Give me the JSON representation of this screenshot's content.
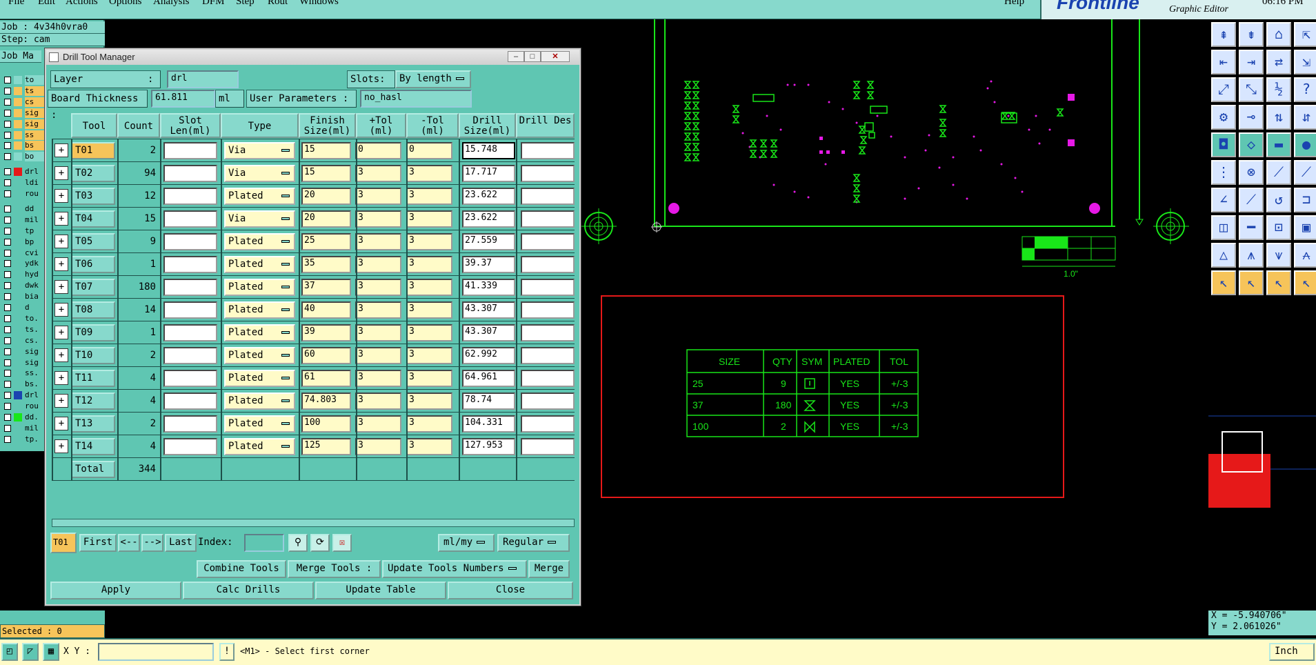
{
  "menubar": {
    "items": [
      "File",
      "Edit",
      "Actions",
      "Options",
      "Analysis",
      "DFM",
      "Step",
      "Rout",
      "Windows",
      "Help"
    ],
    "brand": "Frontline",
    "app_name": "Graphic Editor",
    "time": "06:16 PM"
  },
  "left_panel": {
    "job": "Job : 4v34h0vra0",
    "step": "Step: cam",
    "job_matrix": "Job Ma",
    "layers": [
      "to",
      "ts",
      "cs",
      "sig",
      "sig",
      "ss",
      "bs",
      "bo",
      "drl",
      "ldi",
      "rou",
      "dd",
      "mil",
      "tp",
      "bp",
      "cvi",
      "ydk",
      "hyd",
      "dwk",
      "bia",
      "d",
      "to.",
      "ts.",
      "cs.",
      "sig",
      "sig",
      "ss.",
      "bs.",
      "drl",
      "rou",
      "dd.",
      "mil",
      "tp."
    ],
    "selected": "Selected : 0"
  },
  "dialog": {
    "title": "Drill Tool Manager",
    "layer_label": "Layer",
    "layer_sep": ":",
    "layer_value": "drl",
    "slots_label": "Slots:",
    "slots_value": "By length",
    "board_thickness_label": "Board Thickness :",
    "board_thickness_value": "61.811",
    "board_thickness_unit": "ml",
    "user_params_label": "User Parameters :",
    "user_params_value": "no_hasl",
    "columns": [
      "Tool",
      "Count",
      "Slot Len(ml)",
      "Type",
      "Finish Size(ml)",
      "+Tol (ml)",
      "-Tol (ml)",
      "Drill Size(ml)",
      "Drill Des"
    ],
    "rows": [
      {
        "tool": "T01",
        "count": "2",
        "type": "Via",
        "finish": "15",
        "ptol": "0",
        "mtol": "0",
        "drill": "15.748"
      },
      {
        "tool": "T02",
        "count": "94",
        "type": "Via",
        "finish": "15",
        "ptol": "3",
        "mtol": "3",
        "drill": "17.717"
      },
      {
        "tool": "T03",
        "count": "12",
        "type": "Plated",
        "finish": "20",
        "ptol": "3",
        "mtol": "3",
        "drill": "23.622"
      },
      {
        "tool": "T04",
        "count": "15",
        "type": "Via",
        "finish": "20",
        "ptol": "3",
        "mtol": "3",
        "drill": "23.622"
      },
      {
        "tool": "T05",
        "count": "9",
        "type": "Plated",
        "finish": "25",
        "ptol": "3",
        "mtol": "3",
        "drill": "27.559"
      },
      {
        "tool": "T06",
        "count": "1",
        "type": "Plated",
        "finish": "35",
        "ptol": "3",
        "mtol": "3",
        "drill": "39.37"
      },
      {
        "tool": "T07",
        "count": "180",
        "type": "Plated",
        "finish": "37",
        "ptol": "3",
        "mtol": "3",
        "drill": "41.339"
      },
      {
        "tool": "T08",
        "count": "14",
        "type": "Plated",
        "finish": "40",
        "ptol": "3",
        "mtol": "3",
        "drill": "43.307"
      },
      {
        "tool": "T09",
        "count": "1",
        "type": "Plated",
        "finish": "39",
        "ptol": "3",
        "mtol": "3",
        "drill": "43.307"
      },
      {
        "tool": "T10",
        "count": "2",
        "type": "Plated",
        "finish": "60",
        "ptol": "3",
        "mtol": "3",
        "drill": "62.992"
      },
      {
        "tool": "T11",
        "count": "4",
        "type": "Plated",
        "finish": "61",
        "ptol": "3",
        "mtol": "3",
        "drill": "64.961"
      },
      {
        "tool": "T12",
        "count": "4",
        "type": "Plated",
        "finish": "74.803",
        "ptol": "3",
        "mtol": "3",
        "drill": "78.74"
      },
      {
        "tool": "T13",
        "count": "2",
        "type": "Plated",
        "finish": "100",
        "ptol": "3",
        "mtol": "3",
        "drill": "104.331"
      },
      {
        "tool": "T14",
        "count": "4",
        "type": "Plated",
        "finish": "125",
        "ptol": "3",
        "mtol": "3",
        "drill": "127.953"
      }
    ],
    "total_label": "Total",
    "total_count": "344",
    "nav": {
      "current": "T01",
      "first": "First",
      "prev": "<--",
      "next": "-->",
      "last": "Last",
      "index_label": "Index:",
      "units": "ml/my",
      "mode": "Regular"
    },
    "actions": {
      "combine": "Combine Tools",
      "merge_tools": "Merge Tools :",
      "update_numbers": "Update Tools Numbers",
      "merge": "Merge",
      "apply": "Apply",
      "calc": "Calc Drills",
      "update_table": "Update Table",
      "close": "Close"
    }
  },
  "canvas": {
    "scale_label": "1.0\"",
    "drill_table": {
      "headers": [
        "SIZE",
        "QTY",
        "SYM",
        "PLATED",
        "TOL"
      ],
      "rows": [
        [
          "25",
          "9",
          "",
          "YES",
          "+/-3"
        ],
        [
          "37",
          "180",
          "",
          "YES",
          "+/-3"
        ],
        [
          "100",
          "2",
          "",
          "YES",
          "+/-3"
        ]
      ]
    }
  },
  "coords": {
    "x": "X = -5.940706\"",
    "y": "Y =  2.061026\""
  },
  "statusbar": {
    "xy_label": "X Y :",
    "message": "<M1> - Select first corner",
    "units": "Inch"
  },
  "colors": {
    "panel": "#5fc6b2",
    "light": "#87d9cc",
    "select": "#f6c45a",
    "green": "#19e619",
    "magenta": "#e619e6",
    "red": "#e61919"
  }
}
